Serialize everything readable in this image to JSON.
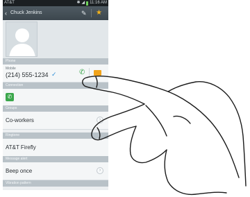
{
  "status_bar": {
    "carrier": "AT&T",
    "time": "11:16 AM"
  },
  "action_bar": {
    "back_icon": "chevron-left",
    "title": "Chuck Jenkins",
    "edit_icon": "pencil",
    "favorite_icon": "star"
  },
  "sections": {
    "phone": "Phone",
    "connection": "Connection",
    "groups": "Groups",
    "ringtone": "Ringtone",
    "message_alert": "Message alert",
    "vibration_pattern": "Vibration pattern"
  },
  "phone_entry": {
    "type": "Mobile",
    "number": "(214) 555-1234",
    "call_icon": "phone-icon",
    "message_icon": "message-icon"
  },
  "connection_icon": "phone-app-icon",
  "groups_value": "Co-workers",
  "ringtone_value": "AT&T Firefly",
  "message_alert_value": "Beep once",
  "colors": {
    "accent_green": "#3aa64b",
    "accent_orange": "#f1a31a",
    "star_gold": "#f2b21b",
    "check_blue": "#2f8fd8"
  }
}
